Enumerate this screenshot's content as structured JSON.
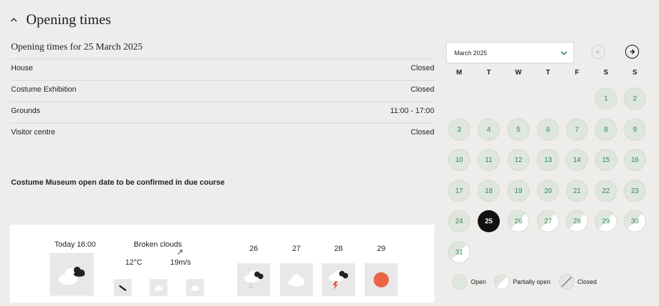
{
  "section": {
    "title": "Opening times",
    "toggle_icon": "chevron-up-icon"
  },
  "opening": {
    "subtitle": "Opening times for 25 March 2025",
    "rows": [
      {
        "name": "House",
        "value": "Closed"
      },
      {
        "name": "Costume Exhibition",
        "value": "Closed"
      },
      {
        "name": "Grounds",
        "value": "11:00 - 17:00"
      },
      {
        "name": "Visitor centre",
        "value": "Closed"
      }
    ],
    "note": "Costume Museum open date to be confirmed in due course"
  },
  "weather": {
    "today_label": "Today 16:00",
    "condition": "Broken clouds",
    "temperature": "12°C",
    "wind": "19m/s",
    "days": [
      "26",
      "27",
      "28",
      "29"
    ],
    "icons": {
      "today": "broken-clouds-icon",
      "small": [
        "rain-icon",
        "cloud-icon",
        "cloud-icon"
      ],
      "days": [
        "sleet-icon",
        "cloud-icon",
        "thunderstorm-icon",
        "sun-icon"
      ]
    }
  },
  "calendar": {
    "month": "March 2025",
    "weekdays": [
      "M",
      "T",
      "W",
      "T",
      "F",
      "S",
      "S"
    ],
    "first_weekday_index": 5,
    "days_in_month": 31,
    "selected_day": 25,
    "partial_days": [
      26,
      27,
      28,
      29,
      30,
      31
    ],
    "colors": {
      "open": "#dee6dd",
      "text": "#2b8a4e",
      "selected": "#111111"
    }
  },
  "legend": {
    "open": "Open",
    "partial": "Partially open",
    "closed": "Closed"
  }
}
